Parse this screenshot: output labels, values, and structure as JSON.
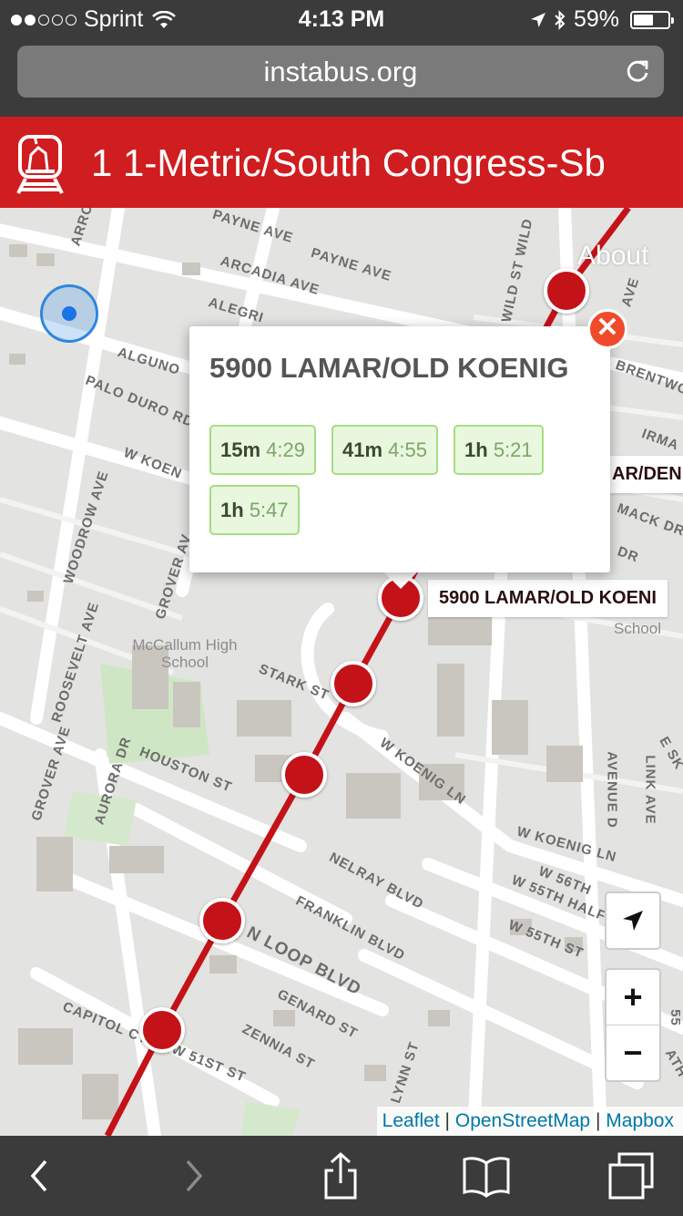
{
  "status_bar": {
    "carrier": "Sprint",
    "time": "4:13 PM",
    "battery": "59%",
    "battery_level": 0.59
  },
  "browser": {
    "url": "instabus.org"
  },
  "header": {
    "title": "1 1-Metric/South Congress-Sb"
  },
  "map": {
    "about_label": "About",
    "streets": [
      "Arro",
      "Payne Ave",
      "Payne Ave",
      "Arcadia Ave",
      "Alegri",
      "Alguno",
      "Palo Duro Rd",
      "W Koen",
      "Woodrow Ave",
      "Grover Av",
      "Roosevelt Ave",
      "Grover Ave",
      "Aurora Dr",
      "Houston St",
      "Stark St",
      "W Koenig Ln",
      "W Koenig Ln",
      "Nelray Blvd",
      "Franklin Blvd",
      "N Loop Blvd",
      "Genard St",
      "Zennia St",
      "Capitol Ct",
      "W 51st St",
      "Lynn St",
      "W 56th",
      "W 55th Half S",
      "W 55th St",
      "Avenue D",
      "Link Ave",
      "E Sk",
      "Wild St Wild",
      "Brentwo",
      "Irma",
      "Mack Dr",
      "Dr",
      "Ave",
      "Ath",
      "55"
    ],
    "pois": [
      {
        "name": "McCallum High School"
      },
      {
        "name": "School"
      }
    ],
    "stop_labels": [
      "5900 LAMAR/OLD KOENI",
      "AR/DEN"
    ]
  },
  "popup": {
    "title": "5900 LAMAR/OLD KOENIG",
    "arrivals": [
      {
        "mins": "15m",
        "clock": "4:29"
      },
      {
        "mins": "41m",
        "clock": "4:55"
      },
      {
        "mins": "1h",
        "clock": "5:21"
      },
      {
        "mins": "1h",
        "clock": "5:47"
      }
    ],
    "close_symbol": "✕"
  },
  "controls": {
    "zoom_in": "+",
    "zoom_out": "−"
  },
  "attribution": {
    "leaflet": "Leaflet",
    "osm": "OpenStreetMap",
    "mapbox": "Mapbox",
    "separator": "|"
  },
  "icons": {
    "wifi": "wifi-icon",
    "location": "location-arrow-icon",
    "bluetooth": "bluetooth-icon",
    "reload": "reload-icon",
    "logo": "train-unicorn-logo-icon",
    "locate": "locate-arrow-icon",
    "back": "back-chevron-icon",
    "forward": "forward-chevron-icon",
    "share": "share-icon",
    "bookmarks": "book-icon",
    "tabs": "tabs-icon"
  },
  "colors": {
    "header_red": "#cf1d20",
    "route_red": "#c41219",
    "arrival_bg": "#e8f7de",
    "arrival_border": "#a6dd83"
  }
}
